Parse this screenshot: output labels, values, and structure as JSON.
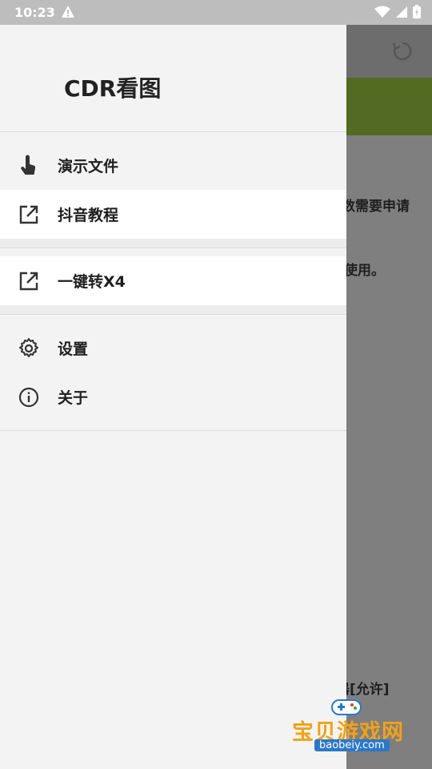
{
  "status_bar": {
    "time": "10:23"
  },
  "drawer": {
    "title": "CDR看图",
    "items": [
      {
        "label": "演示文件",
        "icon": "touch-icon"
      },
      {
        "label": "抖音教程",
        "icon": "open-in-new-icon"
      },
      {
        "label": "一键转X4",
        "icon": "open-in-new-icon"
      },
      {
        "label": "设置",
        "icon": "gear-icon"
      },
      {
        "label": "关于",
        "icon": "info-icon"
      }
    ]
  },
  "background_page": {
    "text_1": "数需要申请",
    "text_2": "使用。",
    "text_3": "器[允许]"
  },
  "watermark": {
    "text": "宝贝游戏网",
    "url": "baobeiy.com"
  },
  "colors": {
    "banner_green": "#526a22",
    "drawer_bg": "#f3f3f3",
    "overlay": "#7f7f7f"
  }
}
